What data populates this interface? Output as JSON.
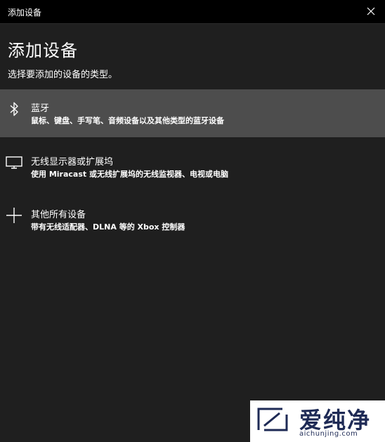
{
  "window": {
    "title": "添加设备"
  },
  "page": {
    "heading": "添加设备",
    "subheading": "选择要添加的设备的类型。"
  },
  "options": [
    {
      "icon": "bluetooth-icon",
      "label": "蓝牙",
      "description": "鼠标、键盘、手写笔、音频设备以及其他类型的蓝牙设备",
      "selected": true
    },
    {
      "icon": "monitor-icon",
      "label": "无线显示器或扩展坞",
      "description": "使用 Miracast 或无线扩展坞的无线监视器、电视或电脑",
      "selected": false
    },
    {
      "icon": "plus-icon",
      "label": "其他所有设备",
      "description": "带有无线适配器、DLNA 等的 Xbox 控制器",
      "selected": false
    }
  ],
  "watermark": {
    "brand": "爱纯净",
    "url": "aichunjing.com"
  },
  "colors": {
    "background": "#1f1f1f",
    "titlebar": "#000000",
    "selected": "#4d4d4d",
    "text": "#ffffff"
  }
}
